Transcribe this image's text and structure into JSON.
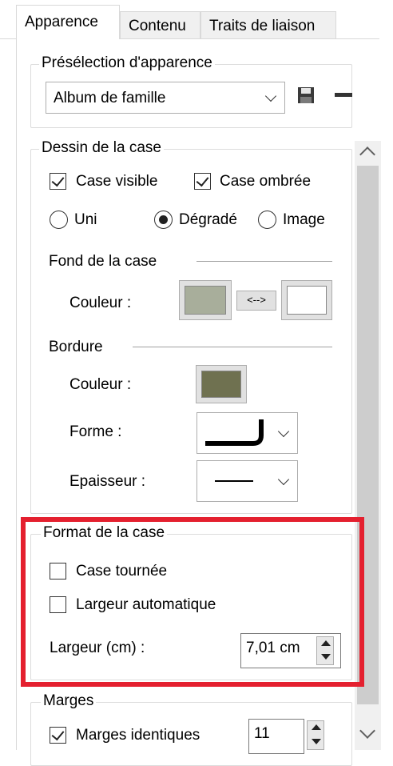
{
  "tabs": [
    {
      "label": "Apparence",
      "active": true
    },
    {
      "label": "Contenu",
      "active": false
    },
    {
      "label": "Traits de liaison",
      "active": false
    }
  ],
  "preset": {
    "legend": "Présélection d'apparence",
    "selected": "Album de famille",
    "save_icon": "floppy-disk-icon",
    "remove_icon": "minus-icon"
  },
  "drawing": {
    "legend": "Dessin de la case",
    "visible_label": "Case visible",
    "visible_checked": true,
    "shadow_label": "Case ombrée",
    "shadow_checked": true,
    "fill_modes": [
      {
        "label": "Uni",
        "checked": false
      },
      {
        "label": "Dégradé",
        "checked": true
      },
      {
        "label": "Image",
        "checked": false
      }
    ],
    "background": {
      "heading": "Fond de la case",
      "color_label": "Couleur :",
      "color1": "#a8ae9b",
      "swap_label": "<-->",
      "color2": "#ffffff"
    },
    "border": {
      "heading": "Bordure",
      "color_label": "Couleur :",
      "color": "#6f7150",
      "shape_label": "Forme :",
      "thickness_label": "Epaisseur :"
    }
  },
  "format": {
    "legend": "Format de la case",
    "rotated_label": "Case tournée",
    "rotated_checked": false,
    "auto_width_label": "Largeur automatique",
    "auto_width_checked": false,
    "width_label": "Largeur (cm) :",
    "width_value": "7,01 cm"
  },
  "margins": {
    "legend": "Marges",
    "identical_label": "Marges identiques",
    "identical_checked": true,
    "value": "11"
  },
  "colors": {
    "highlight": "#e4202f"
  }
}
